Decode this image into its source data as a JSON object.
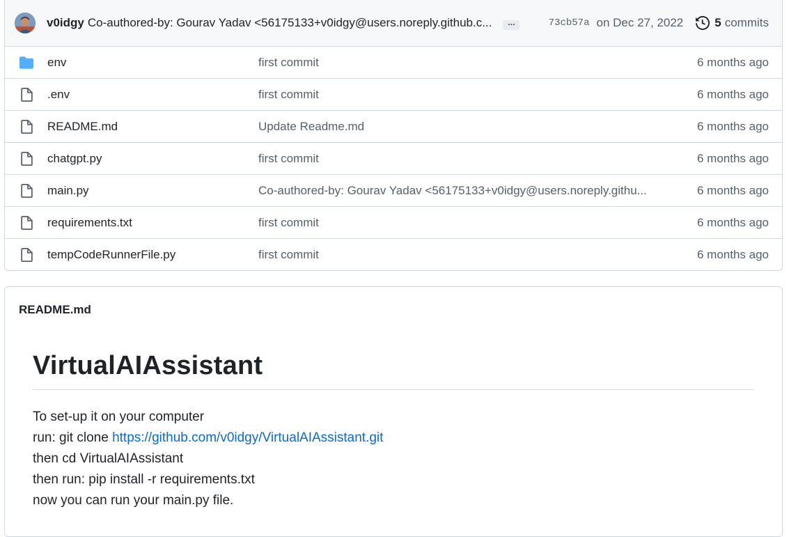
{
  "latest_commit": {
    "author": "v0idgy",
    "message": "Co-authored-by: Gourav Yadav <56175133+v0idgy@users.noreply.github.c...",
    "ellipsis": "…",
    "sha": "73cb57a",
    "date": "on Dec 27, 2022",
    "commits_count": "5",
    "commits_label": "commits"
  },
  "files": [
    {
      "name": "env",
      "type": "folder",
      "message": "first commit",
      "age": "6 months ago"
    },
    {
      "name": ".env",
      "type": "file",
      "message": "first commit",
      "age": "6 months ago"
    },
    {
      "name": "README.md",
      "type": "file",
      "message": "Update Readme.md",
      "age": "6 months ago"
    },
    {
      "name": "chatgpt.py",
      "type": "file",
      "message": "first commit",
      "age": "6 months ago"
    },
    {
      "name": "main.py",
      "type": "file",
      "message": "Co-authored-by: Gourav Yadav <56175133+v0idgy@users.noreply.githu...",
      "age": "6 months ago"
    },
    {
      "name": "requirements.txt",
      "type": "file",
      "message": "first commit",
      "age": "6 months ago"
    },
    {
      "name": "tempCodeRunnerFile.py",
      "type": "file",
      "message": "first commit",
      "age": "6 months ago"
    }
  ],
  "readme": {
    "header": "README.md",
    "title": "VirtualAIAssistant",
    "line1": "To set-up it on your computer",
    "line2_prefix": "run: git clone ",
    "line2_link": "https://github.com/v0idgy/VirtualAIAssistant.git",
    "line3": "then cd VirtualAIAssistant",
    "line4": "then run: pip install -r requirements.txt",
    "line5": "now you can run your main.py file."
  },
  "colors": {
    "folder_icon": "#54aeff",
    "link": "#0969da",
    "muted_text": "#57606a",
    "border": "#d0d7de"
  }
}
